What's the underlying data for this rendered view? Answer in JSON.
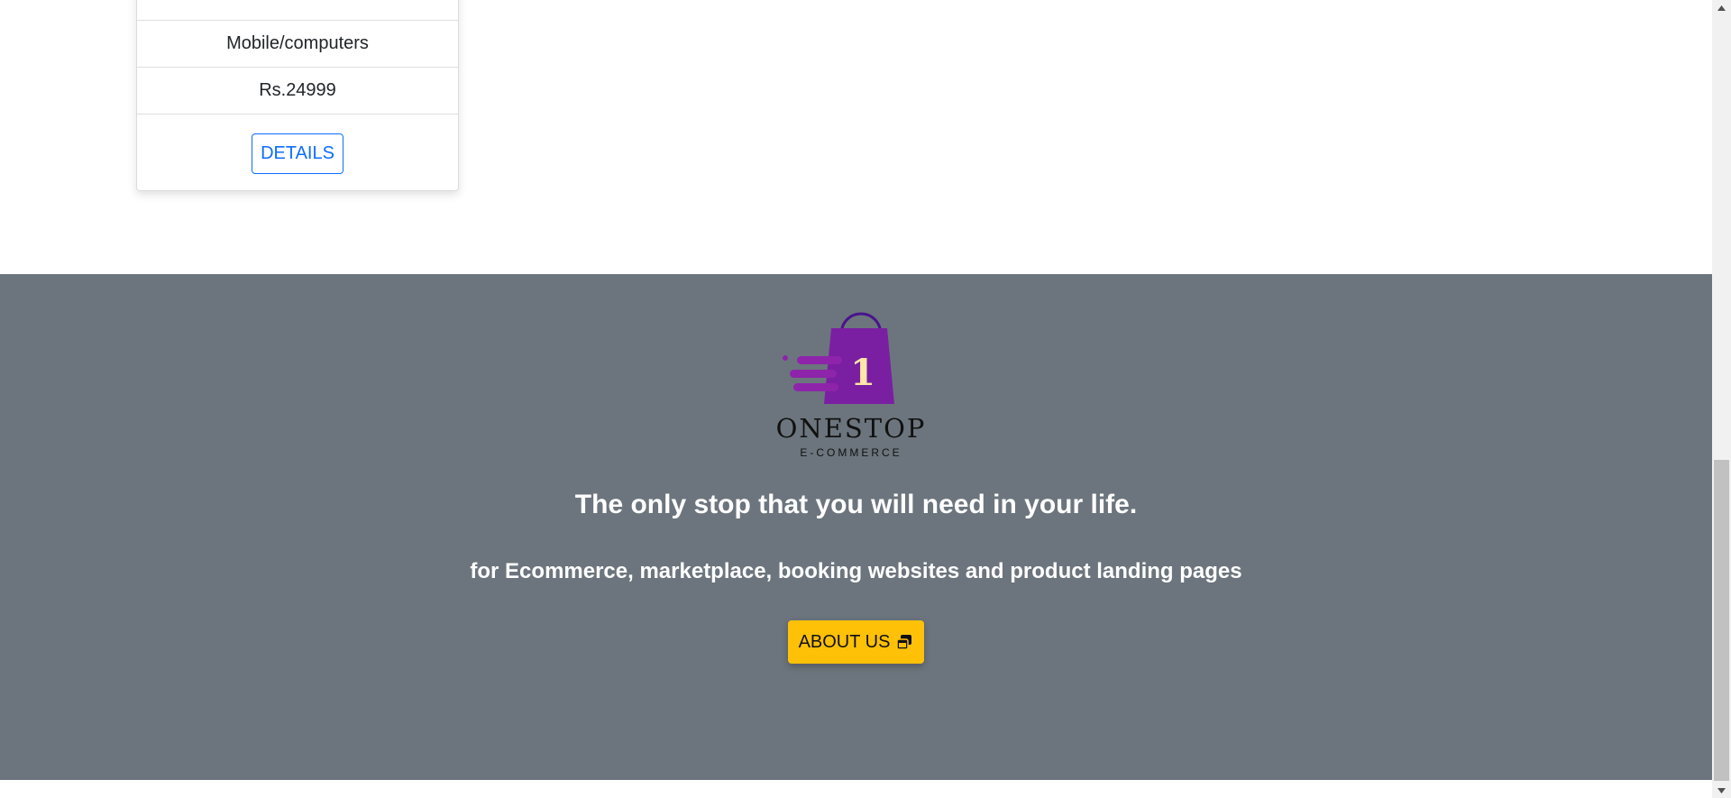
{
  "product_card": {
    "category": "Mobile/computers",
    "price": "Rs.24999",
    "details_label": "DETAILS"
  },
  "footer": {
    "logo_name": "ONESTOP",
    "logo_sub": "E-COMMERCE",
    "logo_badge": "1",
    "tagline": "The only stop that you will need in your life.",
    "subline": "for Ecommerce, marketplace, booking websites and product landing pages",
    "about_label": "ABOUT US",
    "about_icon": "window-restore-icon",
    "background_color": "#6c757d",
    "button_color": "#ffc107",
    "logo_color": "#7b1fa2"
  },
  "scrollbar": {
    "up_icon": "arrow-up-icon",
    "down_icon": "arrow-down-icon"
  }
}
